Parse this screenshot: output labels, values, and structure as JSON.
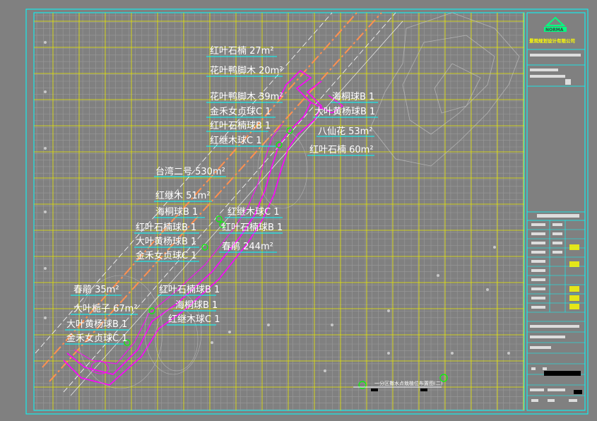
{
  "drawing": {
    "company": "景观规划设计有限公司",
    "logo_text": "NORMA",
    "subtitle": "一分区撒水点栽植位布置图(二)",
    "colors": {
      "background": "#808080",
      "border": "#00ffff",
      "grid": "#ffff00",
      "path": "#ff00ff",
      "text": "#ffffff",
      "road": "#ff8040"
    }
  },
  "labels": [
    {
      "id": "l1",
      "text": "红叶石楠 27m²"
    },
    {
      "id": "l2",
      "text": "花叶鸭脚木 20m²"
    },
    {
      "id": "l3",
      "text": "花叶鸭脚木 39m²"
    },
    {
      "id": "l4",
      "text": "金禾女贞球C 1"
    },
    {
      "id": "l5",
      "text": "红叶石楠球B 1"
    },
    {
      "id": "l6",
      "text": "红继木球C 1"
    },
    {
      "id": "l7",
      "text": "海桐球B 1"
    },
    {
      "id": "l8",
      "text": "大叶黄杨球B 1"
    },
    {
      "id": "l9",
      "text": "八仙花 53m²"
    },
    {
      "id": "l10",
      "text": "红叶石楠 60m²"
    },
    {
      "id": "l11",
      "text": "台湾二号 530m²"
    },
    {
      "id": "l12",
      "text": "红继木 51m²"
    },
    {
      "id": "l13",
      "text": "海桐球B 1"
    },
    {
      "id": "l14",
      "text": "红叶石楠球B 1"
    },
    {
      "id": "l15",
      "text": "大叶黄杨球B 1"
    },
    {
      "id": "l16",
      "text": "金禾女贞球C 1"
    },
    {
      "id": "l17",
      "text": "红继木球C 1"
    },
    {
      "id": "l18",
      "text": "红叶石楠球B 1"
    },
    {
      "id": "l19",
      "text": "春鹃 244m²"
    },
    {
      "id": "l20",
      "text": "春鹃 35m²"
    },
    {
      "id": "l21",
      "text": "大叶栀子 67m²"
    },
    {
      "id": "l22",
      "text": "大叶黄杨球B 1"
    },
    {
      "id": "l23",
      "text": "金禾女贞球C 1"
    },
    {
      "id": "l24",
      "text": "红叶石楠球B 1"
    },
    {
      "id": "l25",
      "text": "海桐球B 1"
    },
    {
      "id": "l26",
      "text": "红继木球C 1"
    }
  ]
}
